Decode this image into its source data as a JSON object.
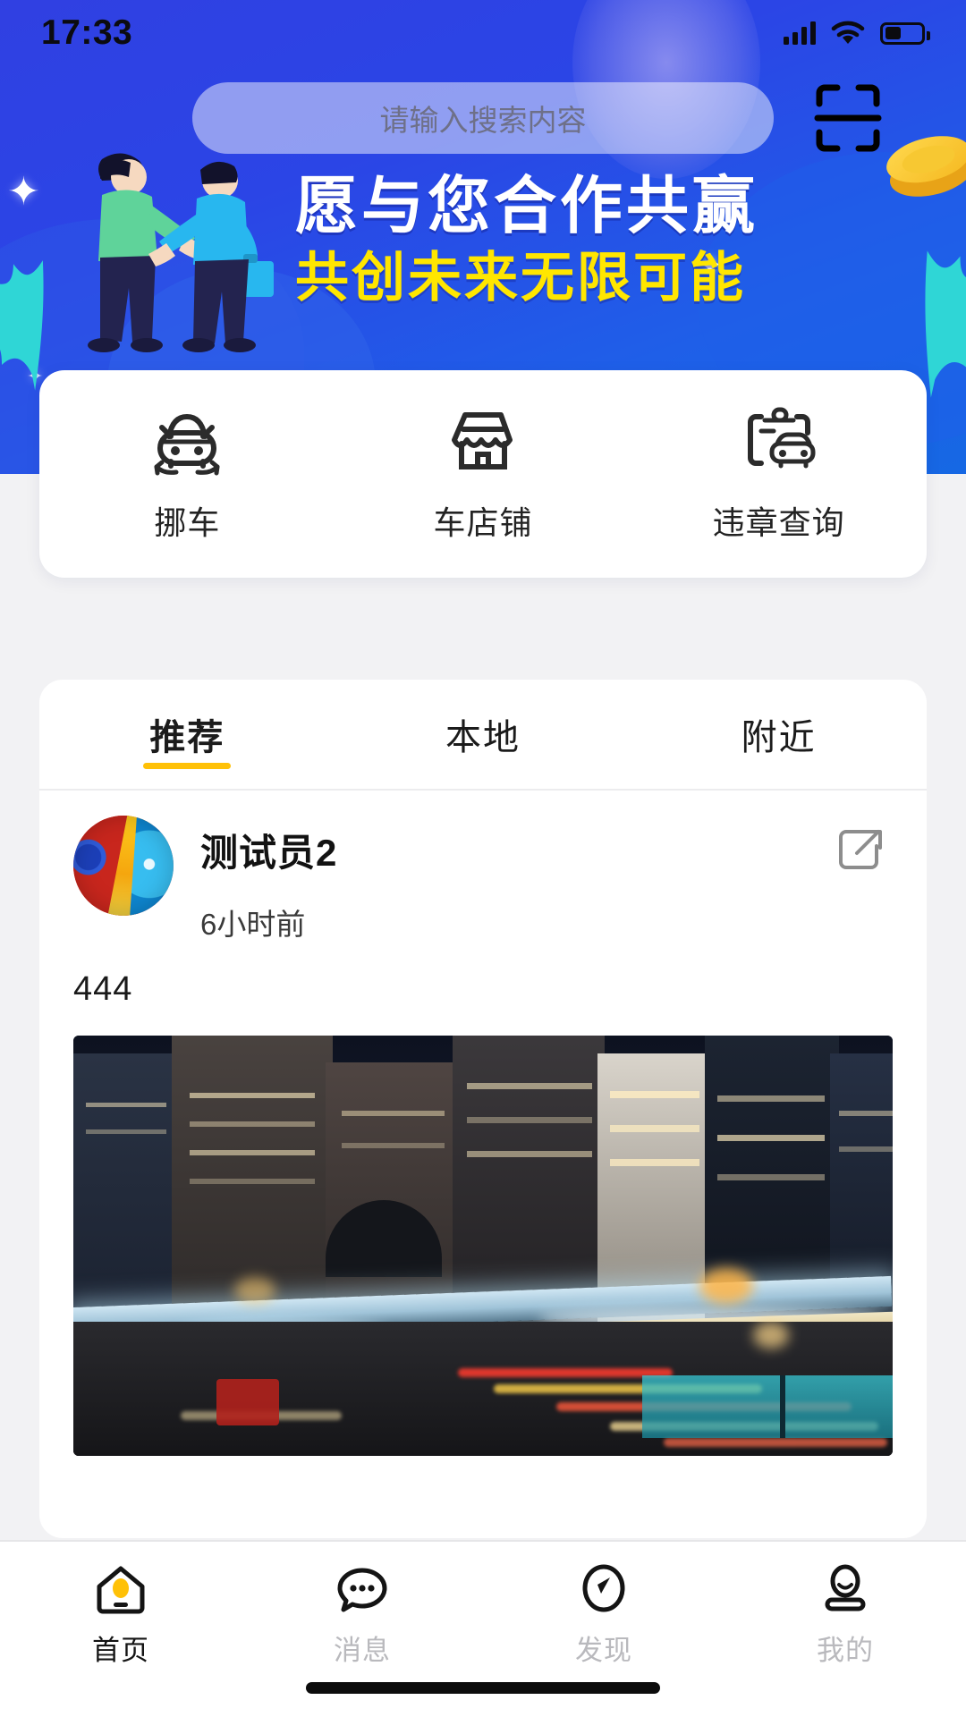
{
  "status_bar": {
    "time": "17:33",
    "signal_icon": "signal-bars-icon",
    "wifi_icon": "wifi-icon",
    "battery_icon": "battery-icon"
  },
  "search": {
    "placeholder": "请输入搜索内容",
    "value": "",
    "scan_icon": "scan-qr-icon"
  },
  "banner": {
    "headline_primary": "愿与您合作共赢",
    "headline_secondary": "共创未来无限可能",
    "primary_color": "#ffffff",
    "secondary_color": "#ffe600",
    "background_color": "#2b45e6",
    "illustration": "handshake-illustration",
    "coin_icon": "gold-coin-icon",
    "leaf_icon": "leaf-decoration-icon",
    "sparkle_icon": "sparkle-icon"
  },
  "quick_actions": [
    {
      "label": "挪车",
      "icon": "car-move-icon"
    },
    {
      "label": "车店铺",
      "icon": "storefront-icon"
    },
    {
      "label": "违章查询",
      "icon": "clipboard-car-icon"
    }
  ],
  "feed": {
    "tabs": [
      {
        "label": "推荐",
        "active": true
      },
      {
        "label": "本地",
        "active": false
      },
      {
        "label": "附近",
        "active": false
      }
    ],
    "active_tab_indicator_color": "#ffc107",
    "posts": [
      {
        "author": "测试员2",
        "time": "6小时前",
        "content": "444",
        "avatar": "colorful-swirl-avatar",
        "share_icon": "external-link-icon",
        "image": "night-city-street-photo"
      }
    ]
  },
  "bottom_nav": [
    {
      "label": "首页",
      "icon": "home-icon",
      "active": true
    },
    {
      "label": "消息",
      "icon": "chat-bubble-icon",
      "active": false
    },
    {
      "label": "发现",
      "icon": "compass-icon",
      "active": false
    },
    {
      "label": "我的",
      "icon": "person-icon",
      "active": false
    }
  ],
  "home_indicator": "home-indicator-bar"
}
